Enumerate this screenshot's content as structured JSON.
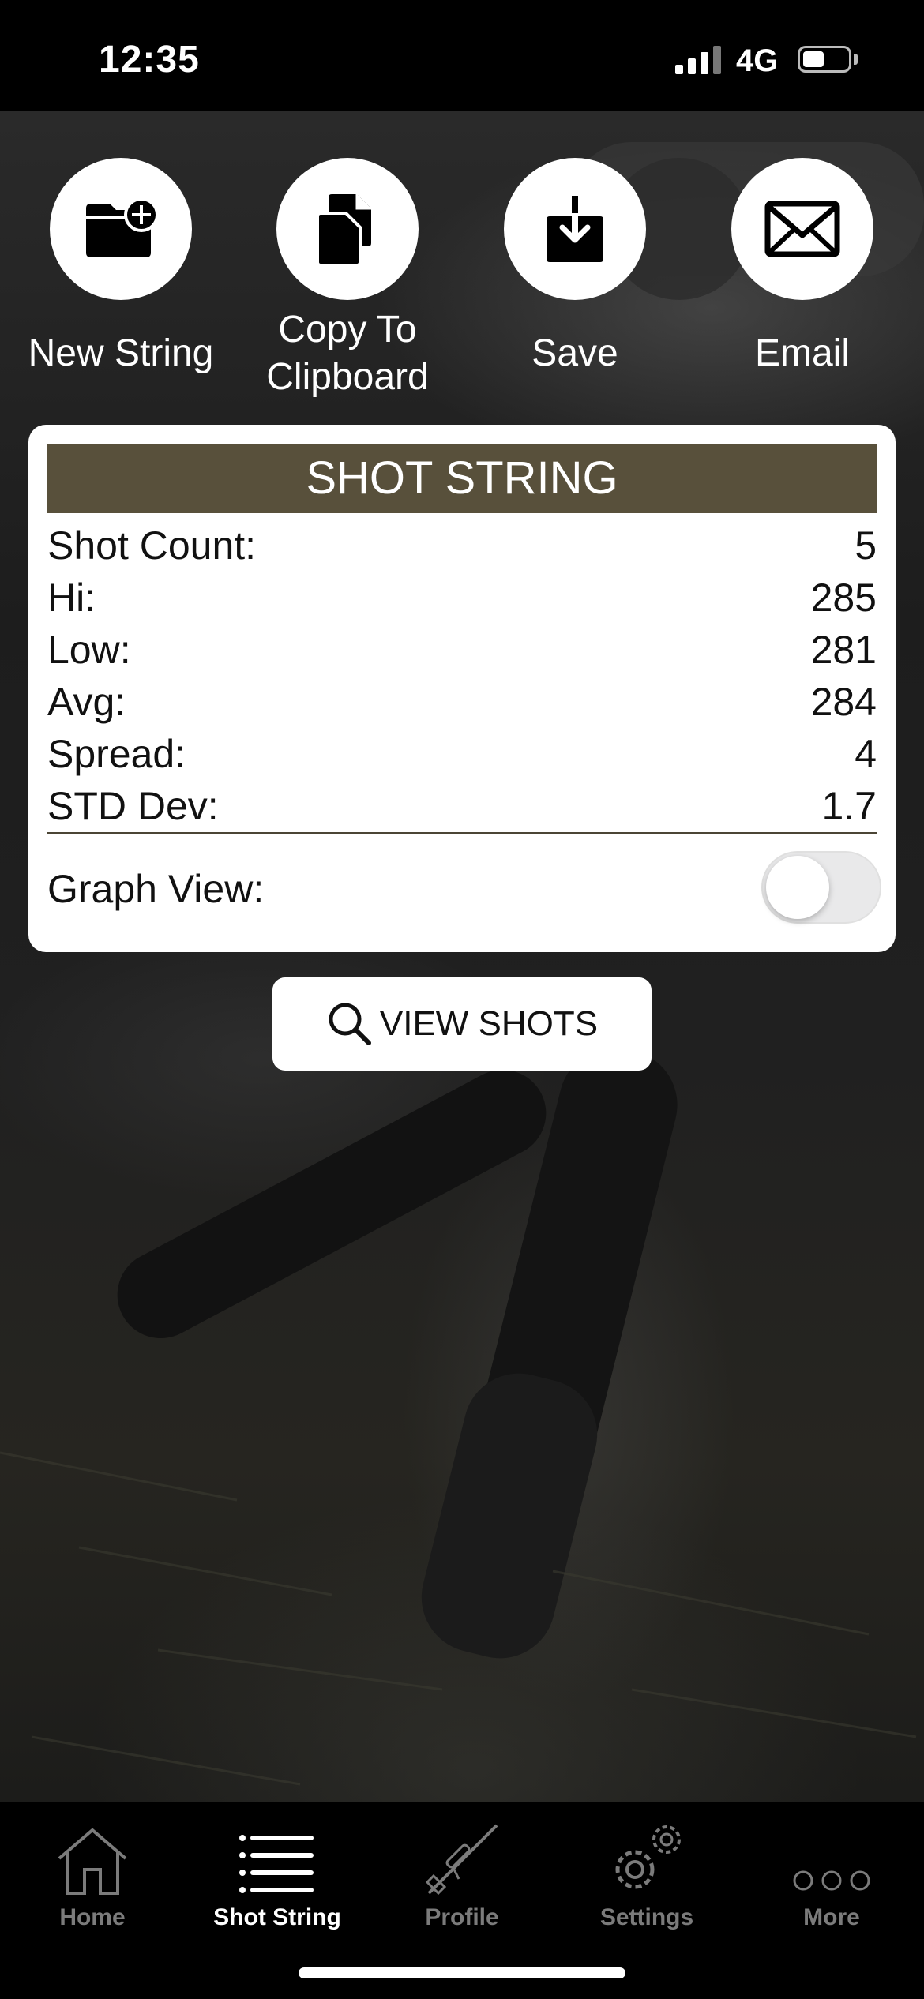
{
  "status_bar": {
    "time": "12:35",
    "network": "4G"
  },
  "actions": [
    {
      "label": "New String",
      "icon": "folder-plus-icon"
    },
    {
      "label_line1": "Copy To",
      "label_line2": "Clipboard",
      "icon": "copy-icon"
    },
    {
      "label": "Save",
      "icon": "download-icon"
    },
    {
      "label": "Email",
      "icon": "envelope-icon"
    }
  ],
  "card": {
    "title": "SHOT STRING",
    "stats": [
      {
        "label": "Shot Count:",
        "value": "5"
      },
      {
        "label": "Hi:",
        "value": "285"
      },
      {
        "label": "Low:",
        "value": "281"
      },
      {
        "label": "Avg:",
        "value": "284"
      },
      {
        "label": "Spread:",
        "value": "4"
      },
      {
        "label": "STD Dev:",
        "value": "1.7"
      }
    ],
    "graph_view_label": "Graph View:",
    "graph_view_on": false
  },
  "view_shots_label": "VIEW SHOTS",
  "tabs": [
    {
      "label": "Home",
      "icon": "home-icon",
      "active": false
    },
    {
      "label": "Shot String",
      "icon": "list-icon",
      "active": true
    },
    {
      "label": "Profile",
      "icon": "rifle-icon",
      "active": false
    },
    {
      "label": "Settings",
      "icon": "gear-icon",
      "active": false
    },
    {
      "label": "More",
      "icon": "more-dots-icon",
      "active": false
    }
  ],
  "colors": {
    "header_bg": "#58503b",
    "divider": "#4b4535"
  }
}
